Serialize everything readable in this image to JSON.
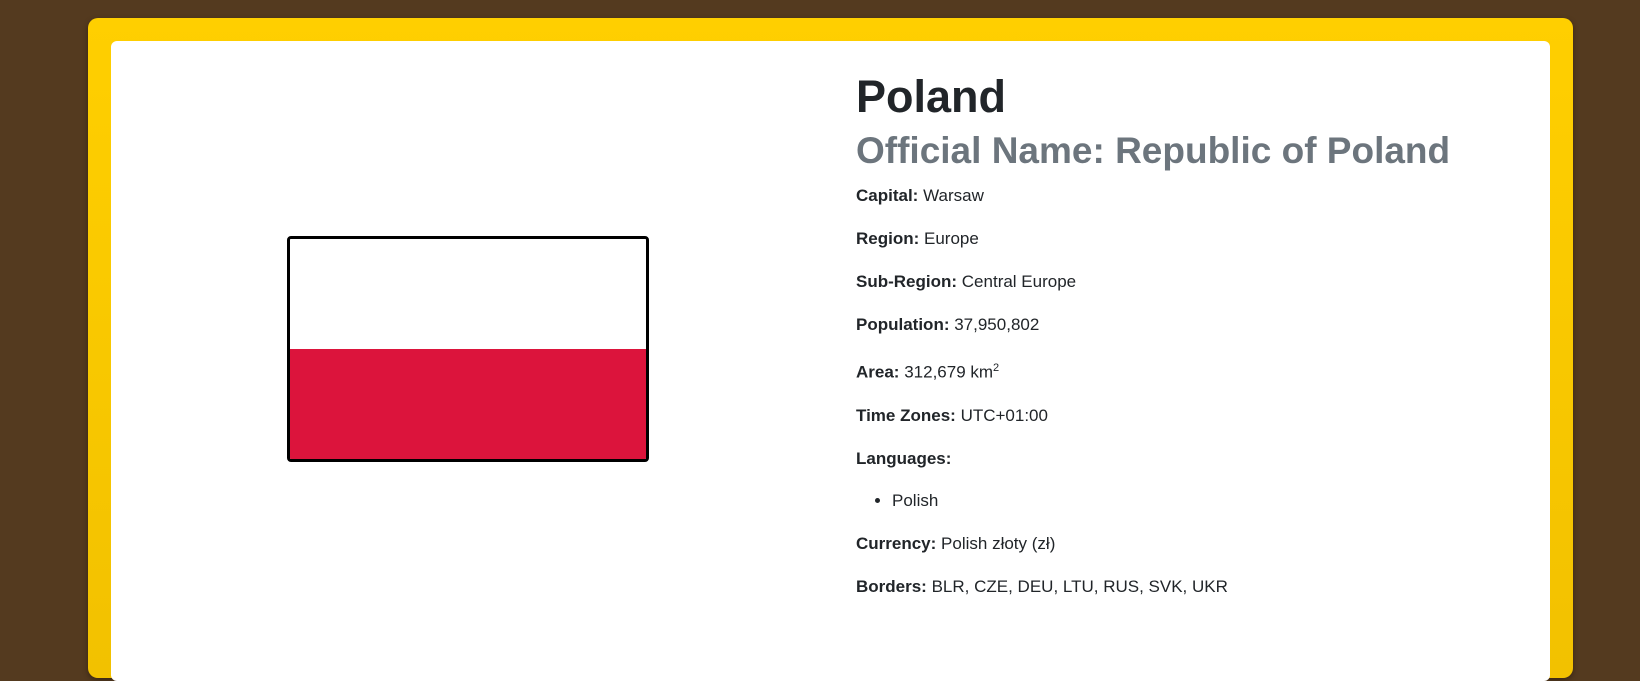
{
  "country": {
    "name": "Poland",
    "official_name": "Official Name: Republic of Poland",
    "flag": {
      "top_color": "#ffffff",
      "bottom_color": "#dc143c"
    },
    "details": {
      "capital_label": "Capital:",
      "capital": "Warsaw",
      "region_label": "Region:",
      "region": "Europe",
      "subregion_label": "Sub-Region:",
      "subregion": "Central Europe",
      "population_label": "Population:",
      "population": "37,950,802",
      "area_label": "Area:",
      "area": "312,679 km",
      "area_unit_sup": "2",
      "timezones_label": "Time Zones:",
      "timezones": "UTC+01:00",
      "languages_label": "Languages:",
      "languages": [
        "Polish"
      ],
      "currency_label": "Currency:",
      "currency": "Polish złoty (zł)",
      "borders_label": "Borders:",
      "borders": "BLR, CZE, DEU, LTU, RUS, SVK, UKR"
    }
  },
  "colors": {
    "background": "#543a1f",
    "frame": "#ffcf00",
    "card": "#ffffff",
    "subtitle": "#6c757d"
  }
}
